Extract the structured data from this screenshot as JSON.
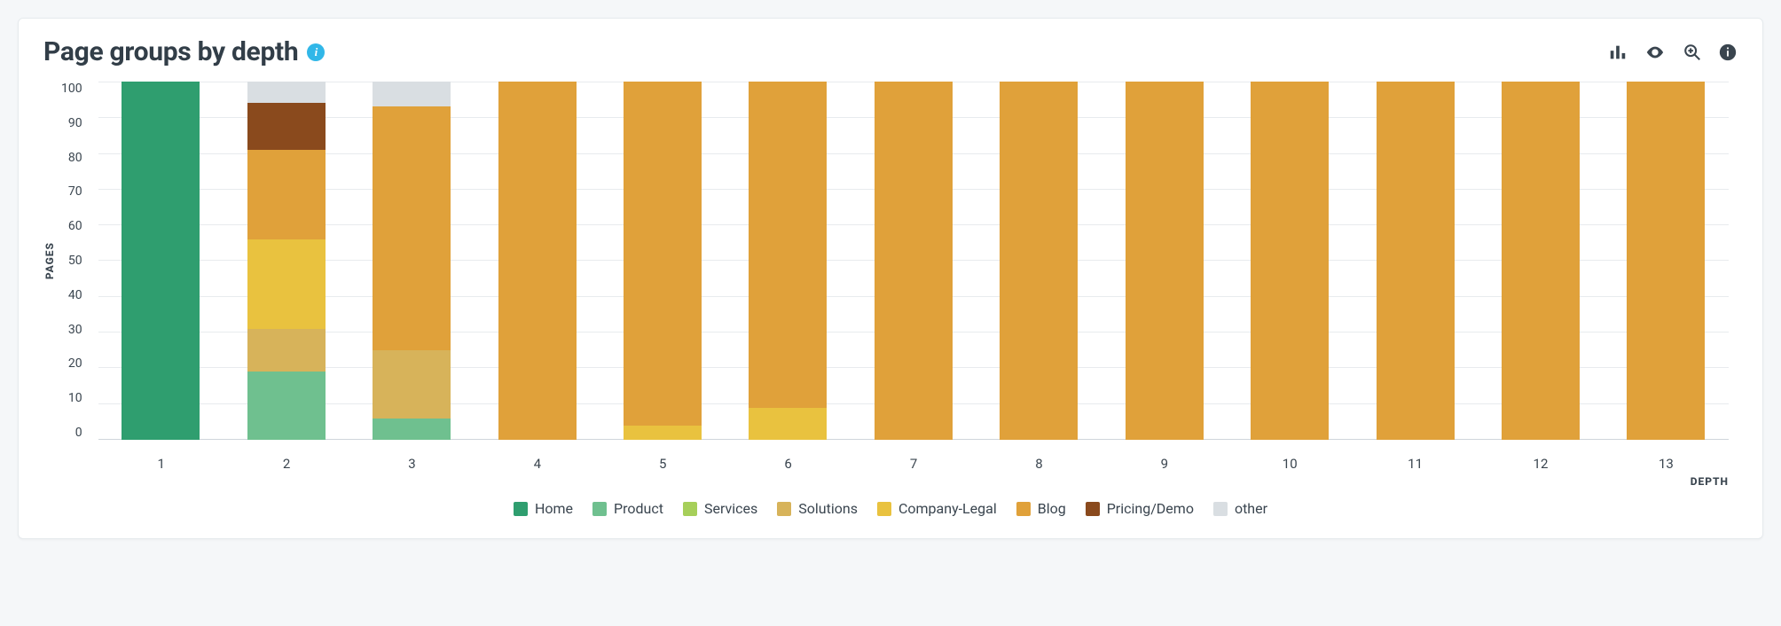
{
  "header": {
    "title": "Page groups by depth"
  },
  "toolbar": {
    "chart_type_label": "Chart type",
    "visibility_label": "Toggle visibility",
    "zoom_label": "Zoom",
    "info_label": "Info"
  },
  "axes": {
    "ylabel": "PAGES",
    "xlabel": "DEPTH",
    "ymax": 100,
    "yticks": [
      100,
      90,
      80,
      70,
      60,
      50,
      40,
      30,
      20,
      10,
      0
    ]
  },
  "legend": [
    {
      "key": "home",
      "label": "Home",
      "color": "#2f9e6f"
    },
    {
      "key": "product",
      "label": "Product",
      "color": "#6fc08f"
    },
    {
      "key": "services",
      "label": "Services",
      "color": "#a6cf5a"
    },
    {
      "key": "solutions",
      "label": "Solutions",
      "color": "#d7b35a"
    },
    {
      "key": "company_legal",
      "label": "Company-Legal",
      "color": "#e9c23f"
    },
    {
      "key": "blog",
      "label": "Blog",
      "color": "#e0a13a"
    },
    {
      "key": "pricing_demo",
      "label": "Pricing/Demo",
      "color": "#8a4a1d"
    },
    {
      "key": "other",
      "label": "other",
      "color": "#d9dee2"
    }
  ],
  "chart_data": {
    "type": "bar",
    "stacked": true,
    "title": "Page groups by depth",
    "xlabel": "DEPTH",
    "ylabel": "PAGES",
    "ylim": [
      0,
      100
    ],
    "categories": [
      "1",
      "2",
      "3",
      "4",
      "5",
      "6",
      "7",
      "8",
      "9",
      "10",
      "11",
      "12",
      "13"
    ],
    "series": [
      {
        "name": "Home",
        "color": "#2f9e6f",
        "values": [
          100,
          0,
          0,
          0,
          0,
          0,
          0,
          0,
          0,
          0,
          0,
          0,
          0
        ]
      },
      {
        "name": "Product",
        "color": "#6fc08f",
        "values": [
          0,
          19,
          6,
          0,
          0,
          0,
          0,
          0,
          0,
          0,
          0,
          0,
          0
        ]
      },
      {
        "name": "Services",
        "color": "#a6cf5a",
        "values": [
          0,
          0,
          0,
          0,
          0,
          0,
          0,
          0,
          0,
          0,
          0,
          0,
          0
        ]
      },
      {
        "name": "Solutions",
        "color": "#d7b35a",
        "values": [
          0,
          12,
          19,
          0,
          0,
          0,
          0,
          0,
          0,
          0,
          0,
          0,
          0
        ]
      },
      {
        "name": "Company-Legal",
        "color": "#e9c23f",
        "values": [
          0,
          25,
          0,
          0,
          4,
          9,
          0,
          0,
          0,
          0,
          0,
          0,
          0
        ]
      },
      {
        "name": "Blog",
        "color": "#e0a13a",
        "values": [
          0,
          25,
          68,
          100,
          96,
          91,
          100,
          100,
          100,
          100,
          100,
          100,
          100
        ]
      },
      {
        "name": "Pricing/Demo",
        "color": "#8a4a1d",
        "values": [
          0,
          13,
          0,
          0,
          0,
          0,
          0,
          0,
          0,
          0,
          0,
          0,
          0
        ]
      },
      {
        "name": "other",
        "color": "#d9dee2",
        "values": [
          0,
          6,
          7,
          0,
          0,
          0,
          0,
          0,
          0,
          0,
          0,
          0,
          0
        ]
      }
    ]
  }
}
